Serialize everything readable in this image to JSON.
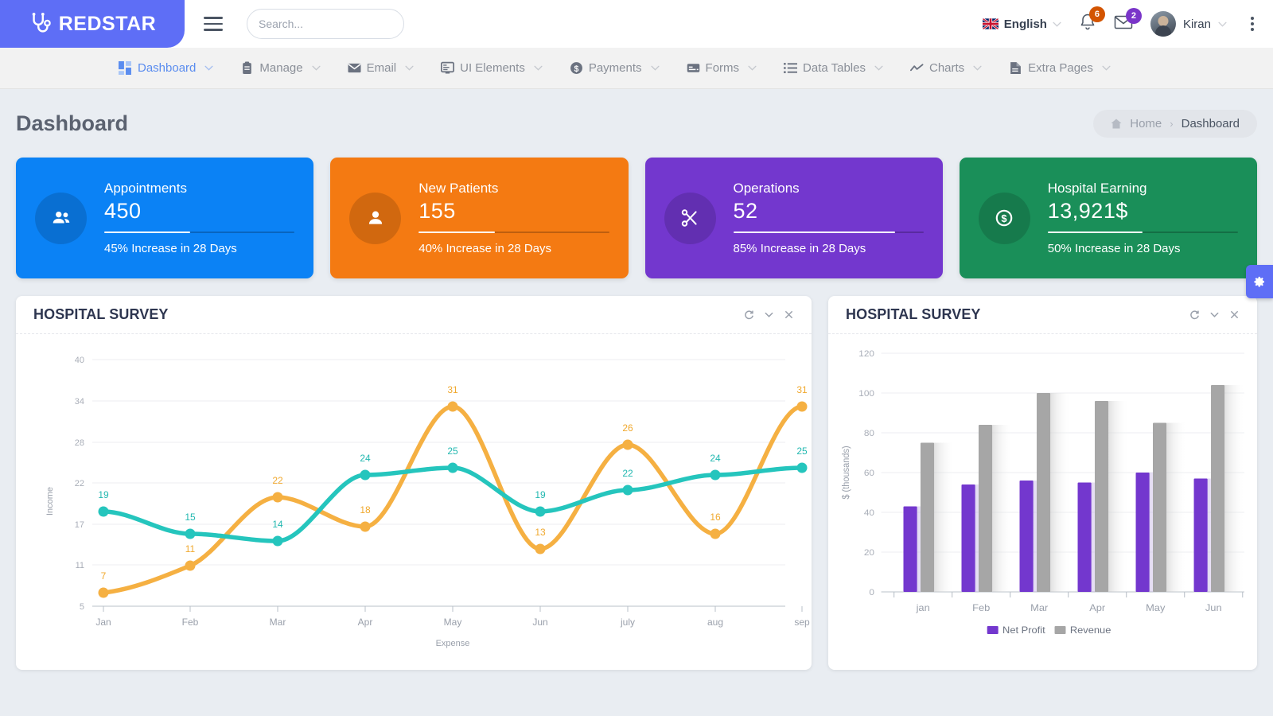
{
  "header": {
    "brand": "REDSTAR",
    "brand_icon": "stethoscope-icon",
    "search_placeholder": "Search...",
    "search_value": "",
    "language": "English",
    "notifications_count": "6",
    "messages_count": "2",
    "user_name": "Kiran",
    "brand_bg": "#5e6ef6"
  },
  "nav": {
    "items": [
      {
        "label": "Dashboard",
        "icon": "grid-icon",
        "active": true
      },
      {
        "label": "Manage",
        "icon": "clipboard-icon",
        "active": false
      },
      {
        "label": "Email",
        "icon": "envelope-icon",
        "active": false
      },
      {
        "label": "UI Elements",
        "icon": "window-icon",
        "active": false
      },
      {
        "label": "Payments",
        "icon": "dollar-icon",
        "active": false
      },
      {
        "label": "Forms",
        "icon": "form-icon",
        "active": false
      },
      {
        "label": "Data Tables",
        "icon": "list-icon",
        "active": false
      },
      {
        "label": "Charts",
        "icon": "trendline-icon",
        "active": false
      },
      {
        "label": "Extra Pages",
        "icon": "file-icon",
        "active": false
      }
    ]
  },
  "page": {
    "title": "Dashboard",
    "breadcrumb": {
      "home": "Home",
      "separator": "›",
      "current": "Dashboard"
    }
  },
  "cards": [
    {
      "label": "Appointments",
      "value": "450",
      "footer": "45% Increase in 28 Days",
      "progress": 45,
      "color": "#0b82f5",
      "icon": "people-icon"
    },
    {
      "label": "New Patients",
      "value": "155",
      "footer": "40% Increase in 28 Days",
      "progress": 40,
      "color": "#f47a12",
      "icon": "person-icon"
    },
    {
      "label": "Operations",
      "value": "52",
      "footer": "85% Increase in 28 Days",
      "progress": 85,
      "color": "#7337ce",
      "icon": "scissors-icon"
    },
    {
      "label": "Hospital Earning",
      "value": "13,921$",
      "footer": "50% Increase in 28 Days",
      "progress": 50,
      "color": "#1a8f59",
      "icon": "dollar-circle-icon"
    }
  ],
  "panels": {
    "left": {
      "title": "HOSPITAL SURVEY",
      "tools": [
        "refresh-icon",
        "chevron-down-icon",
        "close-icon"
      ]
    },
    "right": {
      "title": "HOSPITAL SURVEY",
      "tools": [
        "refresh-icon",
        "chevron-down-icon",
        "close-icon"
      ]
    }
  },
  "chart_data": [
    {
      "type": "line",
      "title": "HOSPITAL SURVEY",
      "xlabel": "Expense",
      "ylabel": "Income",
      "categories": [
        "Jan",
        "Feb",
        "Mar",
        "Apr",
        "May",
        "Jun",
        "july",
        "aug",
        "sep"
      ],
      "yticks": [
        5,
        11,
        17,
        22,
        28,
        34,
        40
      ],
      "ylim": [
        5,
        40
      ],
      "grid": true,
      "legend": "none",
      "series": [
        {
          "name": "Teal",
          "color": "#25c5bd",
          "values": [
            19,
            15,
            14,
            24,
            25,
            19,
            22,
            24,
            25
          ]
        },
        {
          "name": "Orange",
          "color": "#f5b042",
          "values": [
            7,
            11,
            22,
            18,
            31,
            13,
            26,
            16,
            31
          ]
        }
      ]
    },
    {
      "type": "bar",
      "title": "HOSPITAL SURVEY",
      "xlabel": "",
      "ylabel": "$ (thousands)",
      "categories": [
        "jan",
        "Feb",
        "Mar",
        "Apr",
        "May",
        "Jun"
      ],
      "yticks": [
        0,
        20,
        40,
        60,
        80,
        100,
        120
      ],
      "ylim": [
        0,
        120
      ],
      "grid": true,
      "legend": "bottom",
      "series": [
        {
          "name": "Net Profit",
          "color": "#7337ce",
          "values": [
            43,
            54,
            56,
            55,
            60,
            57
          ]
        },
        {
          "name": "Revenue",
          "color": "#a6a6a6",
          "values": [
            75,
            84,
            100,
            96,
            85,
            104
          ]
        }
      ]
    }
  ]
}
